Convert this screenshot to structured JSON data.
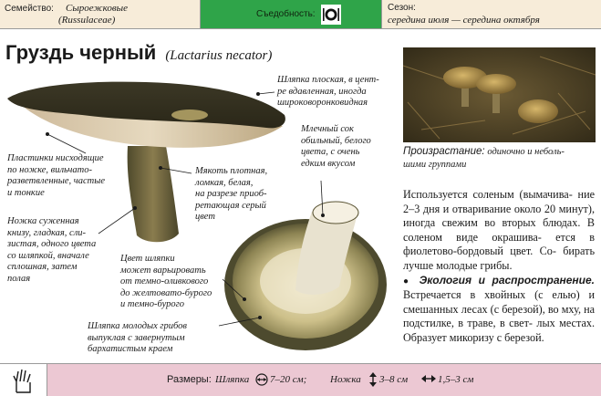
{
  "header": {
    "family_label": "Семейство:",
    "family_value": "Сыроежковые",
    "family_latin": "(Russulaceae)",
    "edibility_label": "Съедобность:",
    "season_label": "Сезон:",
    "season_value": "середина июля — середина октября"
  },
  "title": {
    "russian": "Груздь черный",
    "latin": "(Lactarius necator)"
  },
  "annotations": {
    "cap": [
      "Шляпка плоская, в цент-",
      "ре вдавленная, иногда",
      "широковоронковидная"
    ],
    "plates": [
      "Пластинки нисходящие",
      "по ножке, вильчато-",
      "разветвленные, частые",
      "и тонкие"
    ],
    "flesh": [
      "Мякоть плотная,",
      "ломкая, белая,",
      "на разрезе приоб-",
      "ретающая серый",
      "цвет"
    ],
    "milk": [
      "Млечный сок",
      "обильный, белого",
      "цвета, с очень",
      "едким вкусом"
    ],
    "stem": [
      "Ножка суженная",
      "книзу, гладкая, сли-",
      "зистая, одного цвета",
      "со шляпкой, вначале",
      "сплошная, затем",
      "полая"
    ],
    "cap_color": [
      "Цвет шляпки",
      "может варьировать",
      "от темно-оливкового",
      "до желтовато-бурого",
      "и темно-бурого"
    ],
    "young_cap": [
      "Шляпка молодых грибов",
      "выпуклая с завернутым",
      "бархатистым краем"
    ]
  },
  "habitat": {
    "label": "Произрастание:",
    "line1": "одиночно и неболь-",
    "line2": "шими группами"
  },
  "body": {
    "para1": "Используется соленым (вымачива- ние 2–3 дня и отваривание около 20 минут), иногда свежим во вторых блюдах. В соленом виде окрашива- ется в фиолетово-бордовый цвет. Со- бирать лучше молодые грибы.",
    "eco_heading": "Экология и распространение.",
    "para2": "Встречается в хвойных (с елью) и смешанных лесах (с березой), во мху, на подстилке, в траве, в свет- лых местах. Образует микоризу с березой."
  },
  "footer": {
    "sizes_label": "Размеры:",
    "cap_label": "Шляпка",
    "cap_size": "7–20 см;",
    "stem_label": "Ножка",
    "stem_height": "3–8 см",
    "stem_width": "1,5–3 см"
  },
  "icons": {
    "edibility": "plate-fork-knife-icon",
    "hand": "hand-icon",
    "diameter": "diameter-icon",
    "height": "height-arrow-icon",
    "width": "width-arrow-icon",
    "bullet": "bullet-icon"
  },
  "colors": {
    "edible_green": "#2fa449",
    "header_beige": "#f7ecd9",
    "footer_pink": "#ecc8d3"
  }
}
